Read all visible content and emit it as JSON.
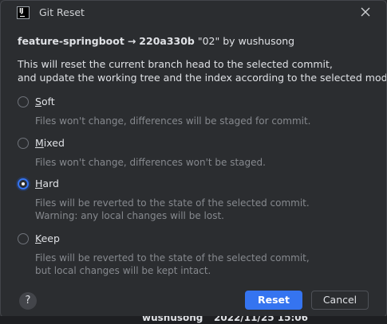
{
  "window": {
    "title": "Git Reset",
    "app_icon": "intellij-icon"
  },
  "header": {
    "branch": "feature-springboot",
    "arrow": "→",
    "hash": "220a330b",
    "commit_message": "\"02\"",
    "by": "by",
    "author": "wushusong"
  },
  "description": {
    "line1": "This will reset the current branch head to the selected commit,",
    "line2": "and update the working tree and the index according to the selected mode:"
  },
  "options": [
    {
      "mnemonic": "S",
      "rest": "oft",
      "desc1": "Files won't change, differences will be staged for commit.",
      "desc2": "",
      "checked": false
    },
    {
      "mnemonic": "M",
      "rest": "ixed",
      "desc1": "Files won't change, differences won't be staged.",
      "desc2": "",
      "checked": false
    },
    {
      "mnemonic": "H",
      "rest": "ard",
      "desc1": "Files will be reverted to the state of the selected commit.",
      "desc2": "Warning: any local changes will be lost.",
      "checked": true
    },
    {
      "mnemonic": "K",
      "rest": "eep",
      "desc1": "Files will be reverted to the state of the selected commit,",
      "desc2": "but local changes will be kept intact.",
      "checked": false
    }
  ],
  "buttons": {
    "help": "?",
    "reset": "Reset",
    "cancel": "Cancel"
  },
  "background_row": {
    "author": "wushusong",
    "date": "2022/11/25 15:06"
  },
  "colors": {
    "accent": "#3574f0",
    "background": "#2b2d30",
    "muted_text": "#86898e"
  }
}
